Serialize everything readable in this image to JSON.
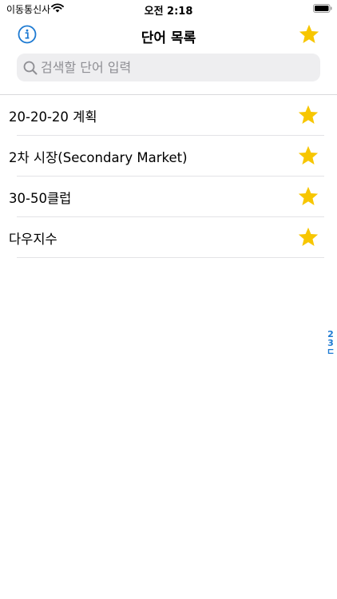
{
  "status": {
    "carrier": "이동통신사",
    "time": "오전 2:18"
  },
  "nav": {
    "title": "단어 목록",
    "info_icon": "info-icon",
    "favorites_icon": "star-icon"
  },
  "search": {
    "placeholder": "검색할 단어 입력",
    "value": ""
  },
  "words": [
    {
      "label": "20-20-20 계획",
      "favorite": true
    },
    {
      "label": "2차 시장(Secondary Market)",
      "favorite": true
    },
    {
      "label": "30-50클럽",
      "favorite": true
    },
    {
      "label": "다우지수",
      "favorite": true
    }
  ],
  "section_index": [
    "2",
    "3",
    "ㄷ"
  ],
  "colors": {
    "accent": "#1d7ad2",
    "star": "#f7c600",
    "search_bg": "#eeeef0"
  }
}
